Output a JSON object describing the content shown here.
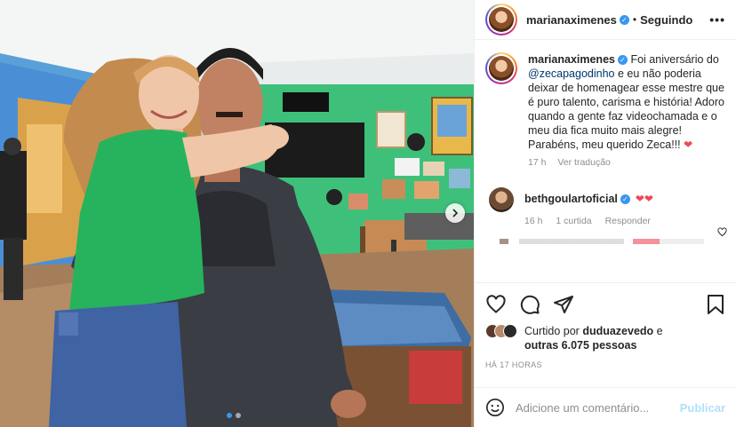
{
  "post": {
    "author": "marianaximenes",
    "follow_status": "Seguindo",
    "separator": "•",
    "more_label": "•••"
  },
  "caption": {
    "username": "marianaximenes",
    "text_before": "Foi aniversário do ",
    "mention": "@zecapagodinho",
    "text_after": " e eu não poderia deixar de homenagear esse mestre que é puro talento, carisma e história! Adoro quando a gente faz videochamada e o meu dia fica muito mais alegre! Parabéns, meu querido Zeca!!! ",
    "emoji": "❤",
    "time": "17 h",
    "translate": "Ver tradução"
  },
  "comments": [
    {
      "username": "bethgoulartoficial",
      "text": "❤❤",
      "time": "16 h",
      "likes": "1 curtida",
      "reply": "Responder"
    }
  ],
  "likes": {
    "prefix": "Curtido por ",
    "user": "duduazevedo",
    "middle": " e",
    "others": "outras 6.075 pessoas"
  },
  "timestamp": "HÁ 17 HORAS",
  "add_comment": {
    "placeholder": "Adicione um comentário...",
    "publish": "Publicar"
  },
  "colors": {
    "accent": "#3897f0",
    "heart": "#ed4956",
    "publish_disabled": "#b2dffc",
    "wall_green": "#3fc07a"
  },
  "icons": [
    "heart-icon",
    "comment-icon",
    "share-icon",
    "bookmark-icon",
    "emoji-icon",
    "verified-icon",
    "chevron-right-icon"
  ],
  "carousel": {
    "slides": 2,
    "active": 0
  }
}
